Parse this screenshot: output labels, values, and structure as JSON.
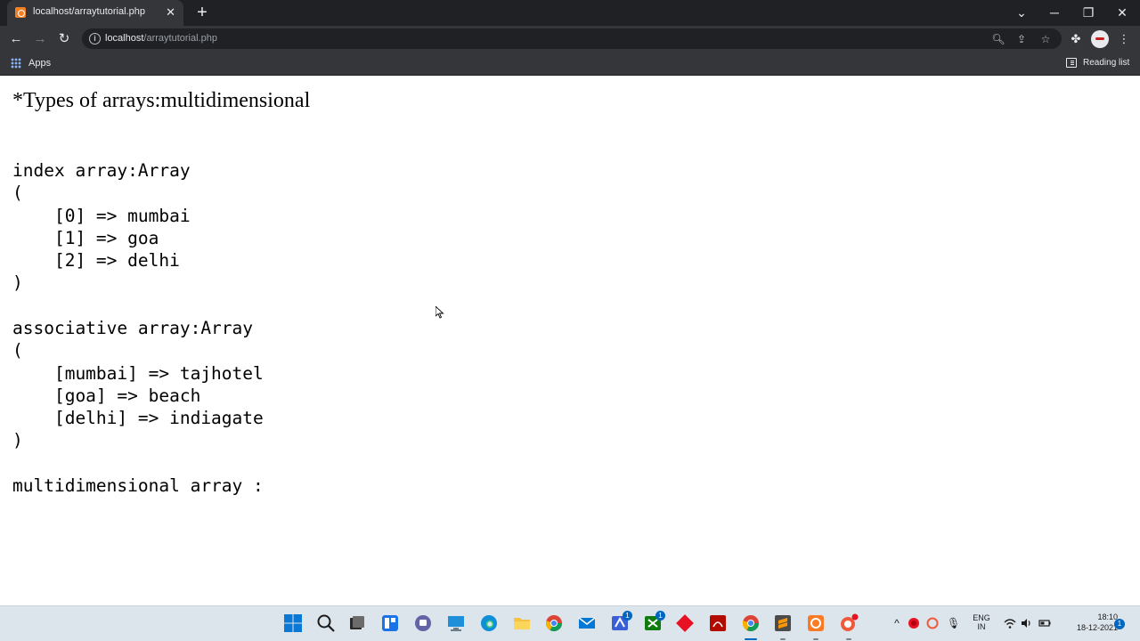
{
  "browser": {
    "tab_title": "localhost/arraytutorial.php",
    "tab_close": "✕",
    "new_tab": "+",
    "url_host": "localhost",
    "url_path": "/arraytutorial.php",
    "bookmarks": {
      "apps_label": "Apps",
      "reading_list_label": "Reading list"
    }
  },
  "page": {
    "heading": "*Types of arrays:multidimensional",
    "index_block": "index array:Array\n(\n    [0] => mumbai\n    [1] => goa\n    [2] => delhi\n)",
    "assoc_block": "associative array:Array\n(\n    [mumbai] => tajhotel\n    [goa] => beach\n    [delhi] => indiagate\n)",
    "multi_line": "multidimensional array :"
  },
  "taskbar": {
    "language_line1": "ENG",
    "language_line2": "IN",
    "time": "18:10",
    "date": "18-12-2021",
    "notification_count": "1",
    "badges": {
      "app1": "1",
      "app2": "1"
    }
  },
  "colors": {
    "tab_strip": "#202124",
    "toolbar": "#35363a",
    "taskbar": "#dde5ec",
    "accent": "#0067c0"
  }
}
